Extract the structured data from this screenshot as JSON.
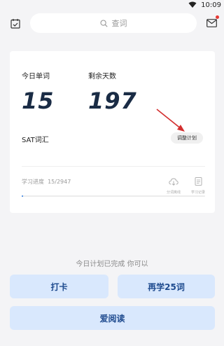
{
  "status_bar": {
    "time": "10:09",
    "icons": [
      "wifi-icon",
      "battery-icon"
    ]
  },
  "header": {
    "left_icon": "calendar-check-icon",
    "right_icon": "mail-icon",
    "search": {
      "placeholder": "查词",
      "icon": "search-icon"
    }
  },
  "card": {
    "today_words_label": "今日单词",
    "today_words_value": "15",
    "days_left_label": "剩余天数",
    "days_left_value": "197",
    "book_name": "SAT词汇",
    "adjust_plan_label": "调整计划",
    "progress_label": "学习进度",
    "progress_value": "15/2947",
    "progress_fraction": 0.005,
    "tools": [
      {
        "label": "分词离线",
        "icon": "cloud-download-icon"
      },
      {
        "label": "学习记录",
        "icon": "document-icon"
      }
    ]
  },
  "done_message": "今日计划已完成 你可以",
  "buttons": {
    "check_in": "打卡",
    "learn_more": "再学25词",
    "reading": "爱阅读"
  },
  "colors": {
    "accent": "#2f7de1",
    "button_bg": "#d9e8fd",
    "button_text": "#1f4b8f",
    "arrow": "#d32f2f"
  }
}
